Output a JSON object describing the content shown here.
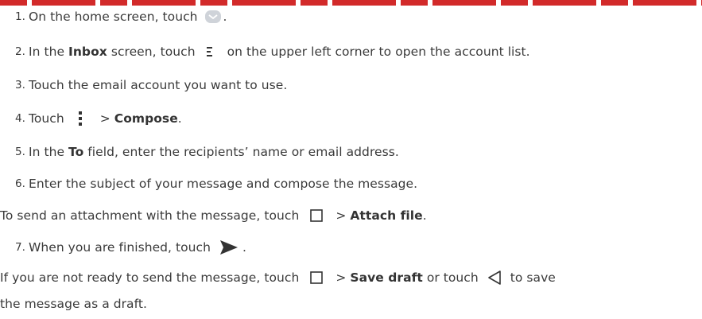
{
  "steps": [
    {
      "num": "1.",
      "pre": "On the home screen, touch",
      "post": "."
    },
    {
      "num": "2.",
      "pre": "In the",
      "bold": "Inbox",
      "mid": "screen, touch",
      "post": "on the upper left corner to open the account list."
    },
    {
      "num": "3.",
      "text": "Touch the email account you want to use."
    },
    {
      "num": "4.",
      "pre": "Touch",
      "mid": ">",
      "bold": "Compose",
      "post": "."
    },
    {
      "num": "5.",
      "pre": "In the",
      "bold": "To",
      "post": "field, enter the recipients’ name or email address."
    },
    {
      "num": "6.",
      "text": "Enter the subject of your message and compose the message."
    },
    {
      "num": "7.",
      "pre": "When you are finished, touch",
      "post": "."
    }
  ],
  "attach_note": {
    "pre": "To send an attachment with the message, touch",
    "mid": ">",
    "bold": "Attach file",
    "post": "."
  },
  "draft_note": {
    "pre": "If you are not ready to send the message, touch",
    "mid": ">",
    "bold": "Save draft",
    "mid2": "or touch",
    "post": "to save",
    "line2": "the message as a draft."
  },
  "icons": {
    "email": "email-app-icon",
    "menu": "menu-icon",
    "more": "more-vertical-icon",
    "square": "square-menu-icon",
    "send": "send-icon",
    "back": "back-triangle-icon"
  }
}
